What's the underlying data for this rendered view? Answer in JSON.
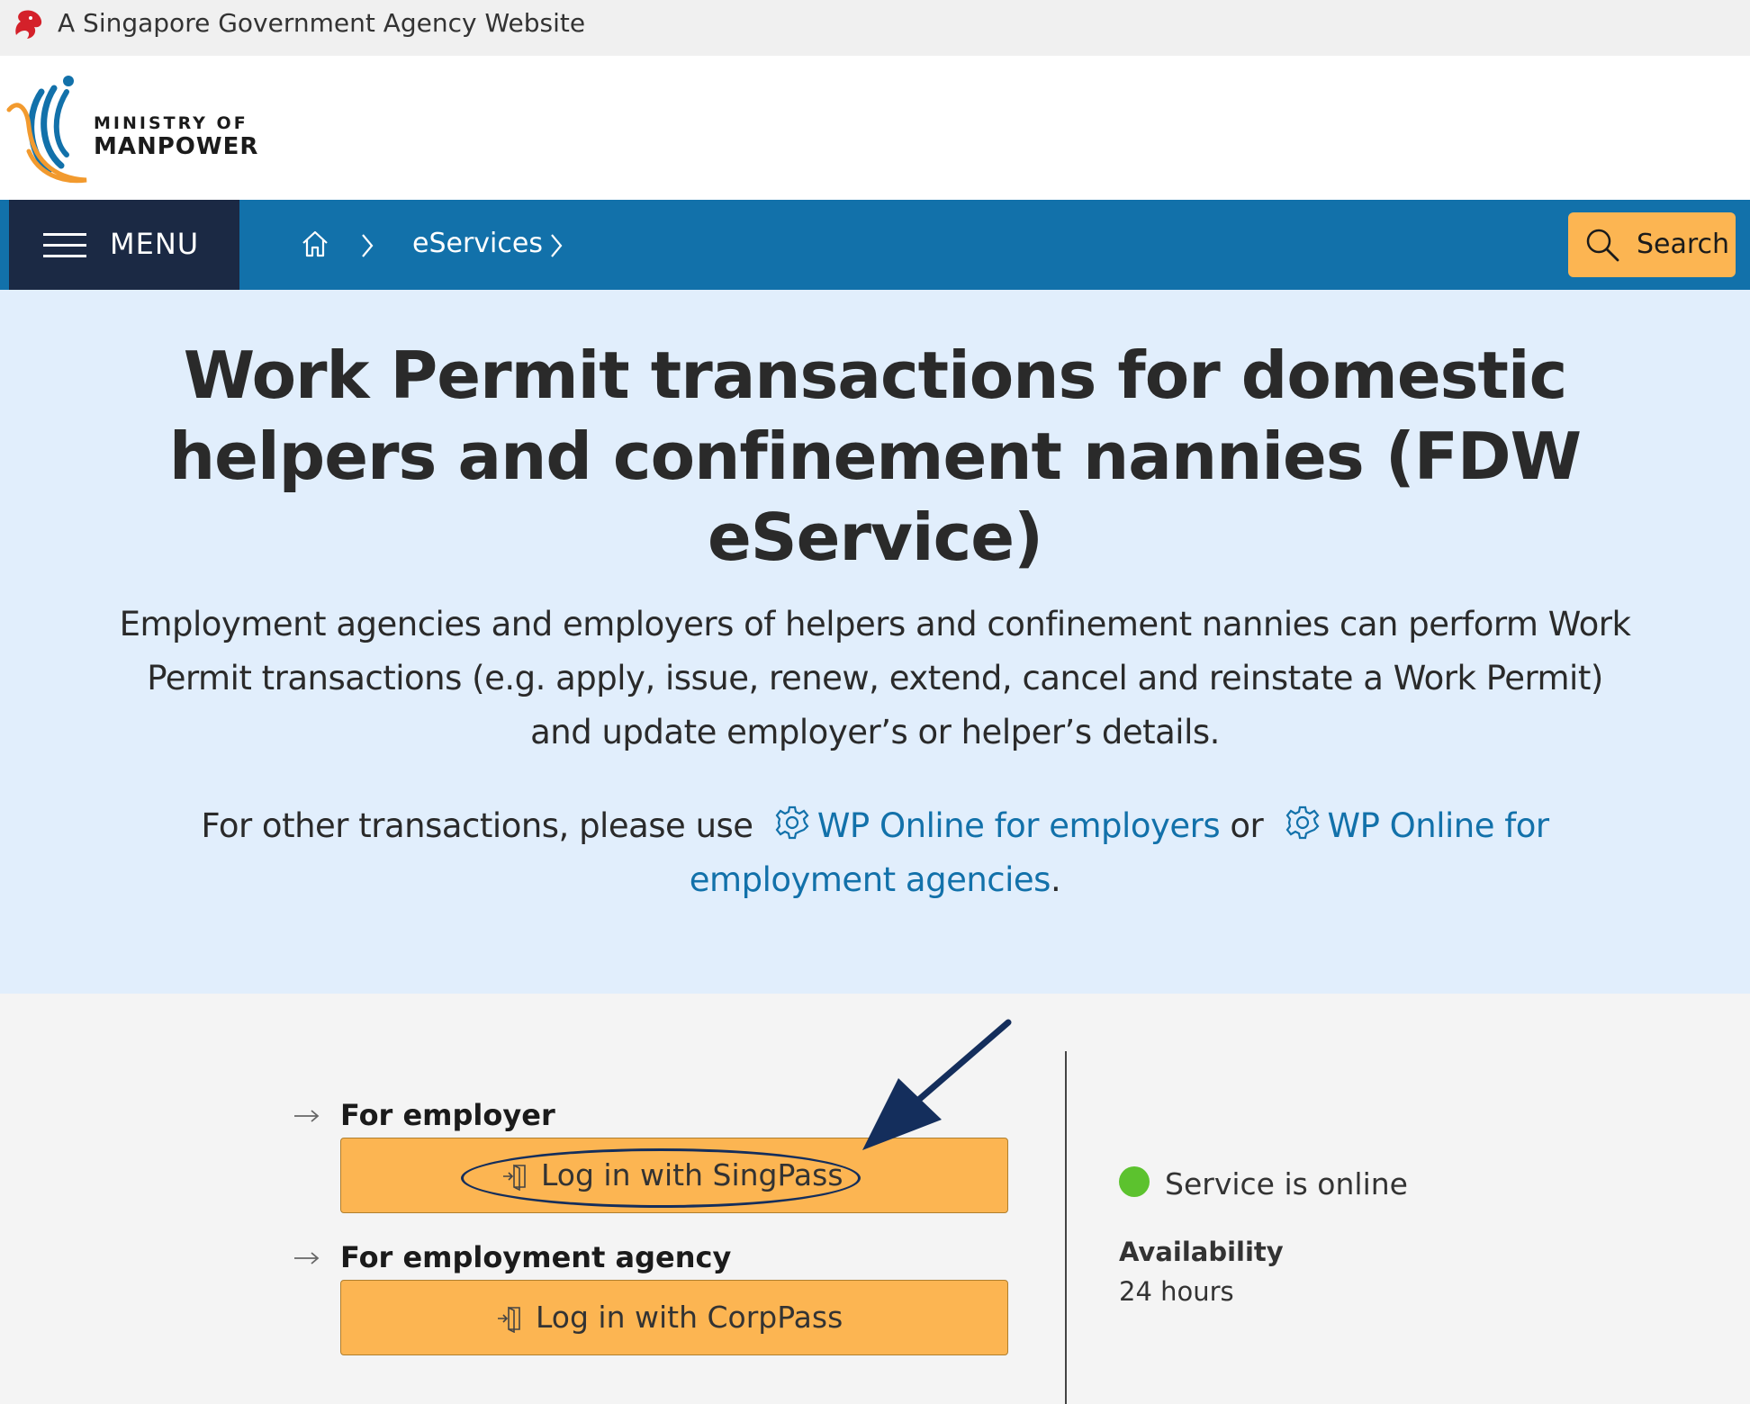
{
  "masthead": {
    "text": "A Singapore Government Agency Website"
  },
  "logo": {
    "line1": "MINISTRY OF",
    "line2": "MANPOWER"
  },
  "nav": {
    "menu_label": "MENU",
    "breadcrumb": [
      {
        "label": "eServices"
      }
    ],
    "search_label": "Search"
  },
  "hero": {
    "title": "Work Permit transactions for domestic helpers and confinement nannies (FDW eService)",
    "description": "Employment agencies and employers of helpers and confinement nannies can perform Work Permit transactions (e.g. apply, issue, renew, extend, cancel and reinstate a Work Permit) and update employer’s or helper’s details.",
    "other_prefix": "For other transactions, please use",
    "link_employers": "WP Online for employers",
    "or_text": "or",
    "link_agencies": "WP Online for employment agencies",
    "period": "."
  },
  "login": {
    "employer_label": "For employer",
    "employer_button": "Log in with SingPass",
    "agency_label": "For employment agency",
    "agency_button": "Log in with CorpPass"
  },
  "status": {
    "text": "Service is online",
    "color": "#5cc22e",
    "availability_label": "Availability",
    "availability_value": "24 hours"
  },
  "colors": {
    "nav_blue": "#1271aa",
    "menu_navy": "#1b2944",
    "accent_orange": "#fcb552",
    "hero_bg": "#e1eefc",
    "annotation": "#142e5c"
  }
}
